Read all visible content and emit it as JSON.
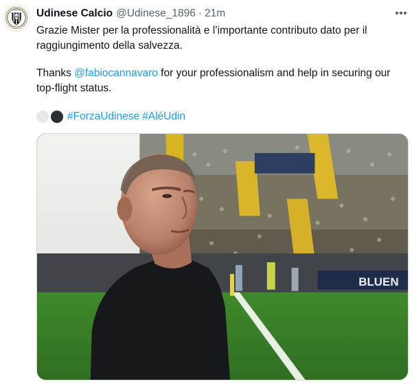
{
  "tweet": {
    "display_name": "Udinese Calcio",
    "handle": "@Udinese_1896",
    "separator": "·",
    "time": "21m",
    "more_icon": "more-horizontal-icon",
    "paragraph1": "Grazie Mister per la professionalità e l’importante contributo dato per il raggiungimento della salvezza.",
    "paragraph2_prefix": "Thanks ",
    "mention": "@fabiocannavaro",
    "paragraph2_suffix": " for your professionalism and help in securing our top-flight status.",
    "emojis": [
      "white-circle-icon",
      "black-circle-icon"
    ],
    "hashtags": [
      "#ForzaUdinese",
      "#AléUdin"
    ],
    "avatar": {
      "icon": "udinese-crest-logo",
      "crest_text": "1896"
    },
    "media": {
      "stadium_banner_text": "BLUEN"
    }
  },
  "colors": {
    "link": "#1d9bf0",
    "secondary_text": "#536471",
    "primary_text": "#0f1419"
  }
}
